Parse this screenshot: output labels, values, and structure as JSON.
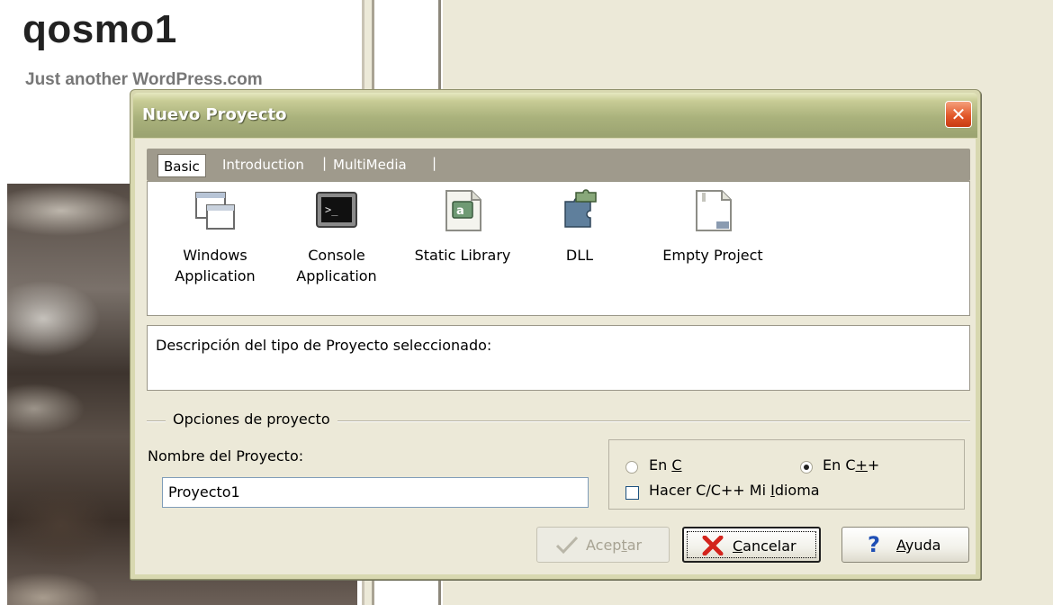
{
  "blog": {
    "title": "qosmo1",
    "tagline": "Just another WordPress.com"
  },
  "dialog": {
    "title": "Nuevo Proyecto",
    "close_icon": "close-icon",
    "tabs": [
      {
        "label": "Basic",
        "active": true
      },
      {
        "label": "Introduction",
        "active": false
      },
      {
        "label": "MultiMedia",
        "active": false
      }
    ],
    "tab_separator": "|",
    "project_types": [
      {
        "line1": "Windows",
        "line2": "Application",
        "icon": "windows-app-icon"
      },
      {
        "line1": "Console",
        "line2": "Application",
        "icon": "console-app-icon"
      },
      {
        "line1": "Static Library",
        "line2": "",
        "icon": "static-library-icon"
      },
      {
        "line1": "DLL",
        "line2": "",
        "icon": "dll-icon"
      },
      {
        "line1": "Empty Project",
        "line2": "",
        "icon": "empty-project-icon"
      }
    ],
    "description": "Descripción del tipo de Proyecto seleccionado:",
    "options_group_title": "Opciones de proyecto",
    "project_name_label": "Nombre del Proyecto:",
    "project_name_value": "Proyecto1",
    "language": {
      "c_prefix": "En ",
      "c_key": "C",
      "c_selected": false,
      "cpp_prefix": "En C",
      "cpp_key": "+",
      "cpp_suffix": "+",
      "cpp_selected": true,
      "default_lang_prefix": "Hacer C/C++ Mi ",
      "default_lang_key": "I",
      "default_lang_suffix": "dioma",
      "default_lang_checked": false
    },
    "buttons": {
      "accept_prefix": "Acep",
      "accept_key": "t",
      "accept_suffix": "ar",
      "accept_enabled": false,
      "cancel_key": "C",
      "cancel_suffix": "ancelar",
      "help_key": "A",
      "help_suffix": "yuda"
    }
  },
  "colors": {
    "titlebar": "#aab27c",
    "close_button": "#e2592b",
    "dialog_face": "#ece9d8",
    "tab_bar": "#9f9a8c"
  }
}
